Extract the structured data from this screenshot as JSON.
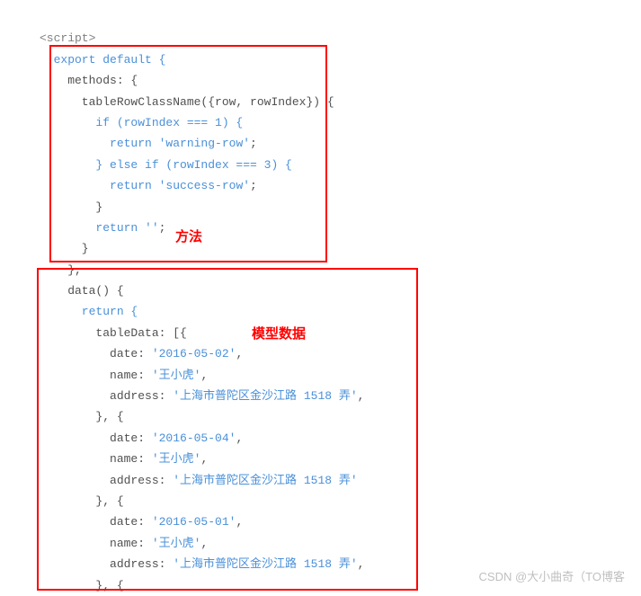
{
  "code": {
    "line1_script_open": "<script>",
    "line2_export": "  export default {",
    "line3_methods": "    methods: {",
    "line4_fn": "      tableRowClassName({row, rowIndex}) {",
    "line5_if": "        if (rowIndex === 1) {",
    "line6_ret_warn_prefix": "          return ",
    "line6_ret_warn_str": "'warning-row'",
    "line6_ret_warn_suffix": ";",
    "line7_elseif": "        } else if (rowIndex === 3) {",
    "line8_ret_succ_prefix": "          return ",
    "line8_ret_succ_str": "'success-row'",
    "line8_ret_succ_suffix": ";",
    "line9_close": "        }",
    "line10_ret_empty_prefix": "        return ",
    "line10_ret_empty_str": "''",
    "line10_ret_empty_suffix": ";",
    "line11_close": "      }",
    "line12_close": "    },",
    "line13_data": "    data() {",
    "line14_return": "      return {",
    "line15_tabledata": "        tableData: [{",
    "line16_date_key": "          date: ",
    "line16_date_val": "'2016-05-02'",
    "line17_name_key": "          name: ",
    "line17_name_val": "'王小虎'",
    "line18_addr_key": "          address: ",
    "line18_addr_val": "'上海市普陀区金沙江路 1518 弄'",
    "line19_sep": "        }, {",
    "line20_date_key": "          date: ",
    "line20_date_val": "'2016-05-04'",
    "line21_name_key": "          name: ",
    "line21_name_val": "'王小虎'",
    "line22_addr_key": "          address: ",
    "line22_addr_val": "'上海市普陀区金沙江路 1518 弄'",
    "line23_sep": "        }, {",
    "line24_date_key": "          date: ",
    "line24_date_val": "'2016-05-01'",
    "line25_name_key": "          name: ",
    "line25_name_val": "'王小虎'",
    "line26_addr_key": "          address: ",
    "line26_addr_val": "'上海市普陀区金沙江路 1518 弄'",
    "line27_sep": "        }, {",
    "comma": ","
  },
  "labels": {
    "methods_label": "方法",
    "data_label": "模型数据"
  },
  "watermark": "CSDN @大小曲奇（TO博客"
}
